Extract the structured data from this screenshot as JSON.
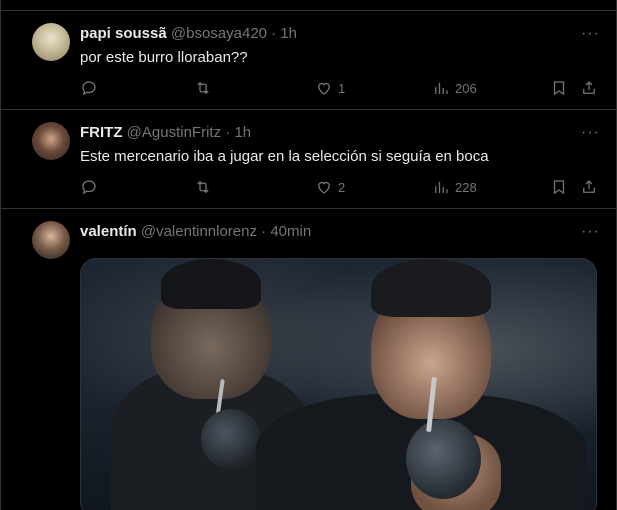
{
  "tweets": [
    {
      "name": "papi soussã",
      "handle": "@bsosaya420",
      "dot": "·",
      "time": "1h",
      "text": "por este burro lloraban??",
      "reply_count": "",
      "retweet_count": "",
      "like_count": "1",
      "view_count": "206"
    },
    {
      "name": "FRITZ",
      "handle": "@AgustinFritz",
      "dot": "·",
      "time": "1h",
      "text": "Este mercenario iba a jugar en la selección si seguía en boca",
      "reply_count": "",
      "retweet_count": "",
      "like_count": "2",
      "view_count": "228"
    },
    {
      "name": "valentín",
      "handle": "@valentinnlorenz",
      "dot": "·",
      "time": "40min"
    }
  ],
  "more_label": "···",
  "icons": {
    "reply": "reply-icon",
    "retweet": "retweet-icon",
    "like": "heart-icon",
    "views": "views-icon",
    "bookmark": "bookmark-icon",
    "share": "share-icon"
  },
  "colors": {
    "background": "#000000",
    "text": "#e7e9ea",
    "muted": "#71767b",
    "border": "#2f3336"
  }
}
